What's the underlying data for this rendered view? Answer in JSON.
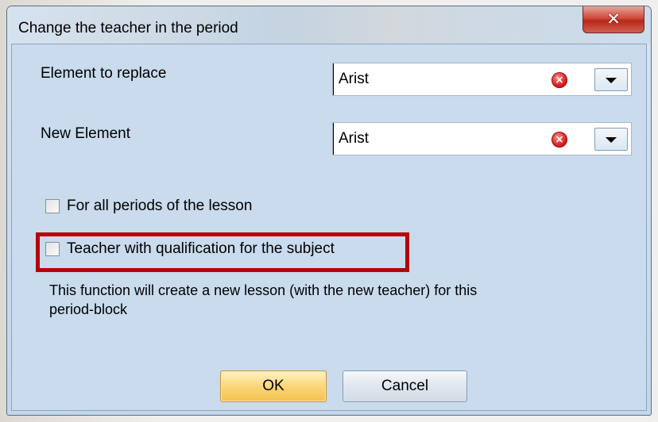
{
  "dialog": {
    "title": "Change the teacher in the period",
    "close_icon": "close-icon"
  },
  "fields": {
    "element_to_replace": {
      "label": "Element to replace",
      "value": "Arist"
    },
    "new_element": {
      "label": "New Element",
      "value": "Arist"
    }
  },
  "options": {
    "all_periods": {
      "label": "For all periods of the lesson",
      "checked": false
    },
    "teacher_qualification": {
      "label": "Teacher with qualification for the subject",
      "checked": false
    }
  },
  "info_text_line1": "This function will create a new lesson (with the new teacher) for this",
  "info_text_line2": "period-block",
  "buttons": {
    "ok": "OK",
    "cancel": "Cancel"
  },
  "colors": {
    "highlight": "#b80000",
    "ok_button": "#fbd67a",
    "close_button": "#cf4b3b"
  }
}
